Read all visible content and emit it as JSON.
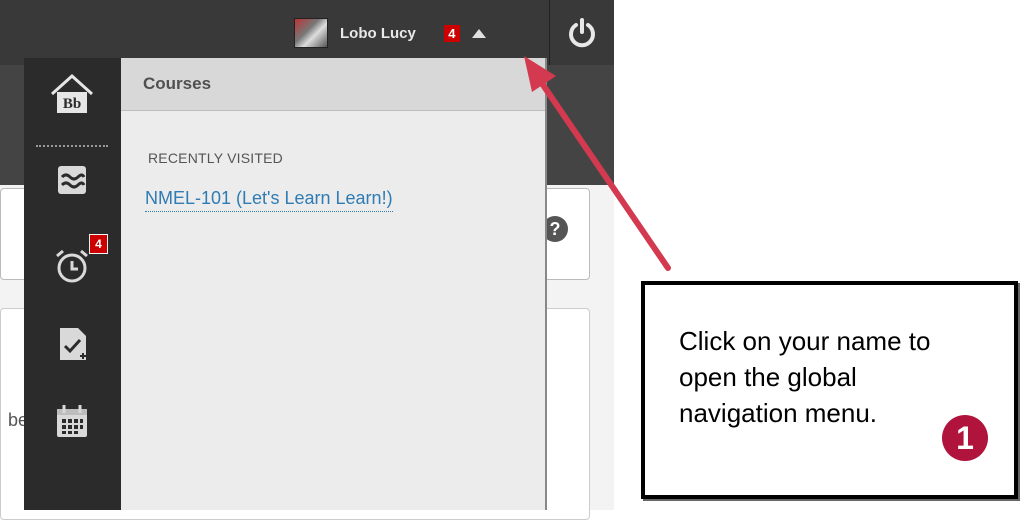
{
  "header": {
    "user_name": "Lobo Lucy",
    "notification_count": "4"
  },
  "sidebar": {
    "alerts_badge": "4",
    "items": [
      {
        "icon": "blackboard-home-icon"
      },
      {
        "icon": "activity-stream-icon"
      },
      {
        "icon": "alarm-clock-icon"
      },
      {
        "icon": "grades-document-icon"
      },
      {
        "icon": "calendar-icon"
      }
    ]
  },
  "courses_panel": {
    "title": "Courses",
    "section_label": "RECENTLY VISITED",
    "recent_course": "NMEL-101 (Let's Learn Learn!)"
  },
  "page": {
    "partial_text": "be"
  },
  "callout": {
    "text": "Click on your name to open the global navigation menu.",
    "step_number": "1"
  },
  "colors": {
    "accent_red": "#c00000",
    "link_blue": "#2e7cb3",
    "arrow_red": "#d33a4f",
    "step_badge": "#b0133b"
  }
}
